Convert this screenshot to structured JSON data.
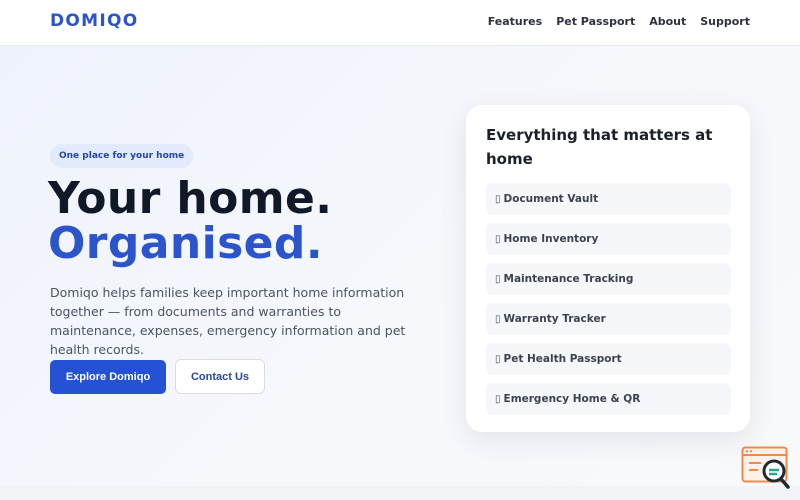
{
  "header": {
    "logo": "DOMIQO",
    "nav": [
      {
        "label": "Features"
      },
      {
        "label": "Pet Passport"
      },
      {
        "label": "About"
      },
      {
        "label": "Support"
      }
    ]
  },
  "hero": {
    "badge": "One place for your home",
    "headline_line1": "Your home.",
    "headline_line2": "Organised.",
    "description": "Domiqo helps families keep important home information together — from documents and warranties to maintenance, expenses, emergency information and pet health records.",
    "primary_button": "Explore Domiqo",
    "secondary_button": "Contact Us"
  },
  "card": {
    "title": "Everything that matters at home",
    "features": [
      {
        "icon": "▯",
        "label": "Document Vault"
      },
      {
        "icon": "▯",
        "label": "Home Inventory"
      },
      {
        "icon": "▯",
        "label": "Maintenance Tracking"
      },
      {
        "icon": "▯",
        "label": "Warranty Tracker"
      },
      {
        "icon": "▯",
        "label": "Pet Health Passport"
      },
      {
        "icon": "▯",
        "label": "Emergency Home & QR"
      }
    ]
  },
  "colors": {
    "brand": "#2c55cc",
    "primary_button": "#2552d4",
    "badge_bg": "#e2eafc",
    "widget_accent": "#f08a4b"
  },
  "widget": {
    "icon": "search-widget-icon"
  }
}
